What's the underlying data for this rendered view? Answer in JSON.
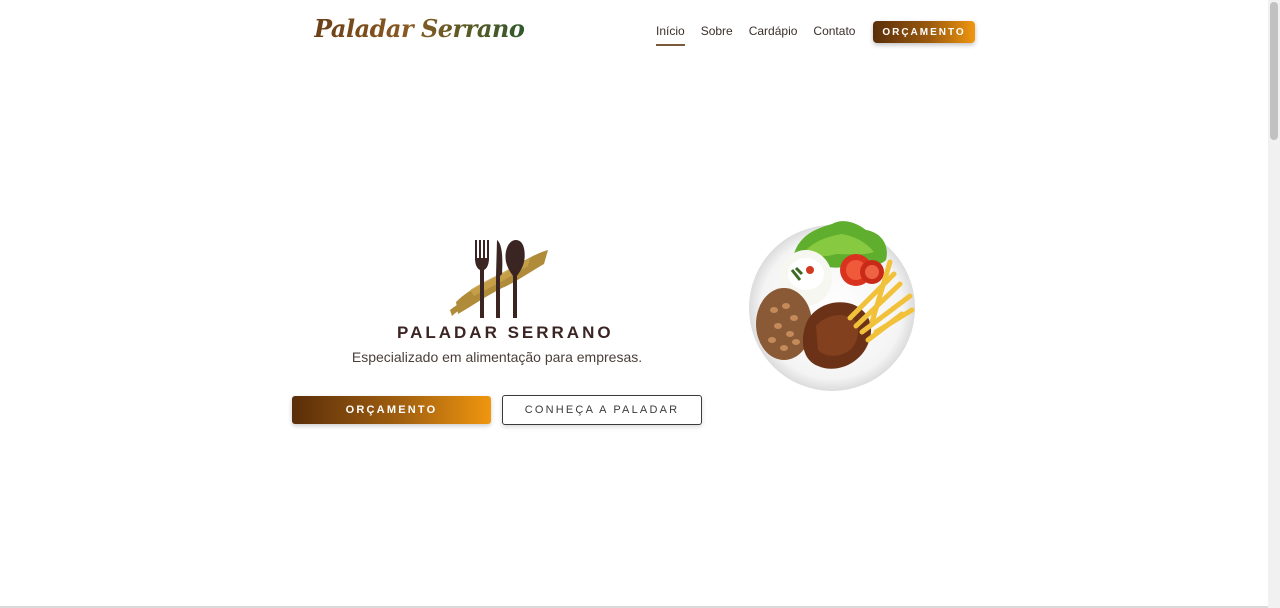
{
  "header": {
    "logo_text": "Paladar Serrano",
    "nav": [
      {
        "label": "Início",
        "active": true
      },
      {
        "label": "Sobre",
        "active": false
      },
      {
        "label": "Cardápio",
        "active": false
      },
      {
        "label": "Contato",
        "active": false
      }
    ],
    "cta_label": "ORÇAMENTO"
  },
  "hero": {
    "brand_icon": "fork-knife-spoon-logo",
    "brand_name": "PALADAR SERRANO",
    "tagline": "Especializado em alimentação para empresas.",
    "primary_button": "ORÇAMENTO",
    "secondary_button": "CONHEÇA A PALADAR",
    "image": "plate-of-food (rice, beans, steak, fries, salad)"
  },
  "colors": {
    "brand_brown": "#5a2e0a",
    "brand_orange": "#f0960f",
    "logo_gold": "#b08b3a",
    "text_dark": "#3b2523"
  }
}
